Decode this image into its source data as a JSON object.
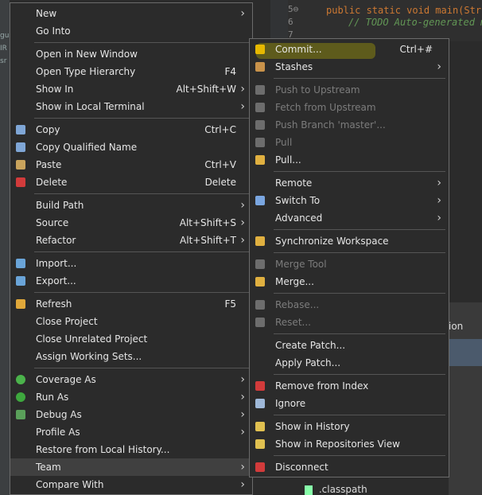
{
  "background": {
    "left_fragments": [
      "gu",
      "IR",
      "sr"
    ],
    "editor": {
      "lines": [
        {
          "num": "5⊖",
          "text": "public static void main(Stri"
        },
        {
          "num": "6",
          "text": "// TODO Auto-generated m"
        },
        {
          "num": "7",
          "text": ""
        }
      ]
    },
    "right_tab": "ion",
    "tree_file": ".classpath"
  },
  "context_menu": {
    "items": [
      {
        "label": "New",
        "arrow": true
      },
      {
        "label": "Go Into"
      },
      {
        "sep": true
      },
      {
        "label": "Open in New Window"
      },
      {
        "label": "Open Type Hierarchy",
        "shortcut": "F4"
      },
      {
        "label": "Show In",
        "shortcut": "Alt+Shift+W",
        "arrow": true
      },
      {
        "label": "Show in Local Terminal",
        "arrow": true
      },
      {
        "sep": true
      },
      {
        "label": "Copy",
        "shortcut": "Ctrl+C",
        "icon": "copy-icon"
      },
      {
        "label": "Copy Qualified Name",
        "icon": "copy-qualified-icon"
      },
      {
        "label": "Paste",
        "shortcut": "Ctrl+V",
        "icon": "paste-icon"
      },
      {
        "label": "Delete",
        "shortcut": "Delete",
        "icon": "delete-icon"
      },
      {
        "sep": true
      },
      {
        "label": "Build Path",
        "arrow": true
      },
      {
        "label": "Source",
        "shortcut": "Alt+Shift+S",
        "arrow": true
      },
      {
        "label": "Refactor",
        "shortcut": "Alt+Shift+T",
        "arrow": true
      },
      {
        "sep": true
      },
      {
        "label": "Import...",
        "icon": "import-icon"
      },
      {
        "label": "Export...",
        "icon": "export-icon"
      },
      {
        "sep": true
      },
      {
        "label": "Refresh",
        "shortcut": "F5",
        "icon": "refresh-icon"
      },
      {
        "label": "Close Project"
      },
      {
        "label": "Close Unrelated Project"
      },
      {
        "label": "Assign Working Sets..."
      },
      {
        "sep": true
      },
      {
        "label": "Coverage As",
        "arrow": true,
        "icon": "coverage-icon"
      },
      {
        "label": "Run As",
        "arrow": true,
        "icon": "run-icon"
      },
      {
        "label": "Debug As",
        "arrow": true,
        "icon": "debug-icon"
      },
      {
        "label": "Profile As",
        "arrow": true
      },
      {
        "label": "Restore from Local History..."
      },
      {
        "label": "Team",
        "arrow": true,
        "highlight": true
      },
      {
        "label": "Compare With",
        "arrow": true
      }
    ]
  },
  "team_menu": {
    "items": [
      {
        "label": "Commit...",
        "shortcut": "Ctrl+#",
        "icon": "commit-icon",
        "marker": true
      },
      {
        "label": "Stashes",
        "arrow": true,
        "icon": "stashes-icon"
      },
      {
        "sep": true
      },
      {
        "label": "Push to Upstream",
        "disabled": true,
        "icon": "push-icon"
      },
      {
        "label": "Fetch from Upstream",
        "disabled": true,
        "icon": "fetch-icon"
      },
      {
        "label": "Push Branch 'master'...",
        "disabled": true,
        "icon": "push-branch-icon"
      },
      {
        "label": "Pull",
        "disabled": true,
        "icon": "pull-icon"
      },
      {
        "label": "Pull...",
        "icon": "pull-dialog-icon"
      },
      {
        "sep": true
      },
      {
        "label": "Remote",
        "arrow": true
      },
      {
        "label": "Switch To",
        "arrow": true,
        "icon": "switch-icon"
      },
      {
        "label": "Advanced",
        "arrow": true
      },
      {
        "sep": true
      },
      {
        "label": "Synchronize Workspace",
        "icon": "sync-icon"
      },
      {
        "sep": true
      },
      {
        "label": "Merge Tool",
        "disabled": true,
        "icon": "merge-tool-icon"
      },
      {
        "label": "Merge...",
        "icon": "merge-icon"
      },
      {
        "sep": true
      },
      {
        "label": "Rebase...",
        "disabled": true,
        "icon": "rebase-icon"
      },
      {
        "label": "Reset...",
        "disabled": true,
        "icon": "reset-icon"
      },
      {
        "sep": true
      },
      {
        "label": "Create Patch..."
      },
      {
        "label": "Apply Patch..."
      },
      {
        "sep": true
      },
      {
        "label": "Remove from Index",
        "icon": "remove-index-icon"
      },
      {
        "label": "Ignore",
        "icon": "ignore-icon"
      },
      {
        "sep": true
      },
      {
        "label": "Show in History",
        "icon": "history-icon"
      },
      {
        "label": "Show in Repositories View",
        "icon": "repositories-icon"
      },
      {
        "sep": true
      },
      {
        "label": "Disconnect",
        "icon": "disconnect-icon"
      }
    ]
  },
  "colors": {
    "commit_marker": "#bfb400",
    "highlight": "#404040",
    "disabled": "#7c7c7c"
  }
}
